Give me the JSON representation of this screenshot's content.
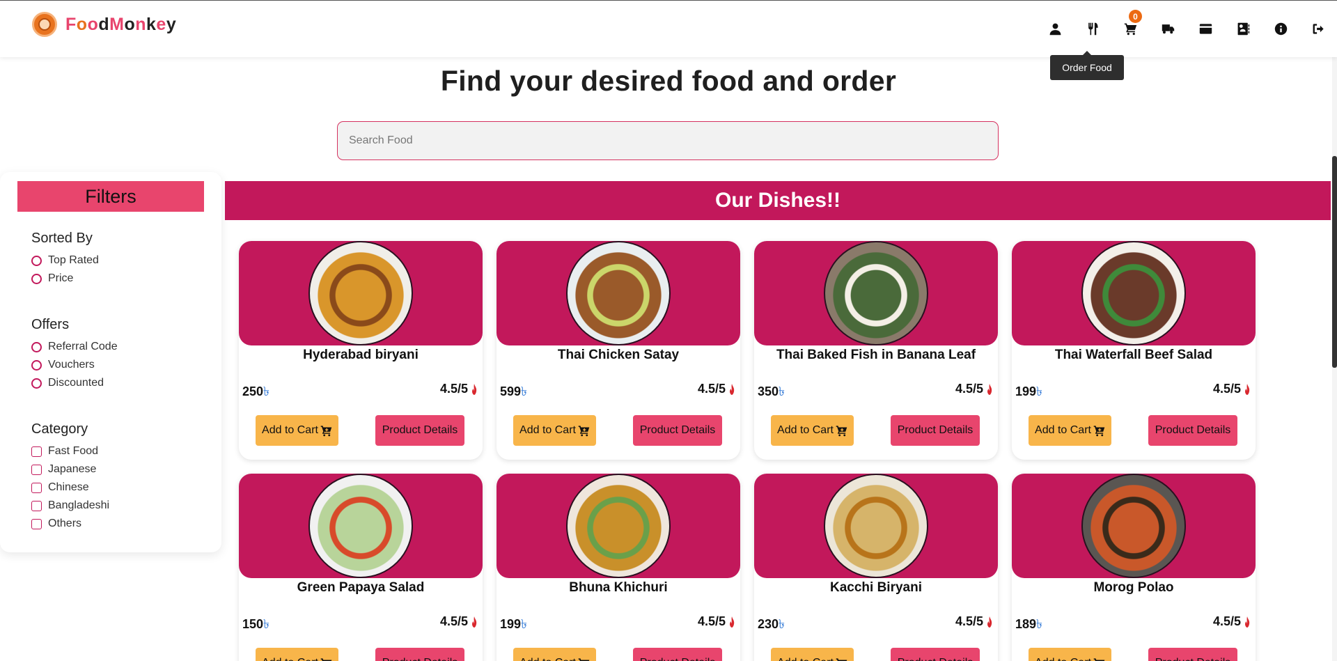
{
  "brand": {
    "name_parts": [
      "F",
      "o",
      "o",
      "d",
      "M",
      "o",
      "n",
      "k",
      "e",
      "y"
    ],
    "name_colors": [
      "#e8456d",
      "#e8731f",
      "#e8456d",
      "#222222",
      "#e8456d",
      "#222222",
      "#e8456d",
      "#222222",
      "#e8456d",
      "#222222"
    ]
  },
  "nav": {
    "icons": [
      "user-icon",
      "utensils-icon",
      "cart-icon",
      "truck-icon",
      "credit-card-icon",
      "contacts-icon",
      "info-icon",
      "logout-icon"
    ],
    "cart_count": "0",
    "tooltip": "Order Food"
  },
  "hero": {
    "headline": "Find your desired food and order",
    "search_placeholder": "Search Food"
  },
  "filters": {
    "title": "Filters",
    "sorted_by": {
      "title": "Sorted By",
      "options": [
        "Top Rated",
        "Price"
      ]
    },
    "offers": {
      "title": "Offers",
      "options": [
        "Referral Code",
        "Vouchers",
        "Discounted"
      ]
    },
    "category": {
      "title": "Category",
      "options": [
        "Fast Food",
        "Japanese",
        "Chinese",
        "Bangladeshi",
        "Others"
      ]
    }
  },
  "dishes": {
    "banner": "Our Dishes!!",
    "currency": "৳",
    "add_to_cart_label": "Add to Cart",
    "details_label": "Product Details",
    "items": [
      {
        "name": "Hyderabad biryani",
        "price": "250",
        "rating": "4.5/5",
        "plate": "#f0eee8",
        "food": "#d9962b",
        "accent": "#8a4a1a"
      },
      {
        "name": "Thai Chicken Satay",
        "price": "599",
        "rating": "4.5/5",
        "plate": "#e9eef0",
        "food": "#9a5a2a",
        "accent": "#cbd66a"
      },
      {
        "name": "Thai Baked Fish in Banana Leaf",
        "price": "350",
        "rating": "4.5/5",
        "plate": "#8a7a6a",
        "food": "#4a6a3a",
        "accent": "#f4efe6"
      },
      {
        "name": "Thai Waterfall Beef Salad",
        "price": "199",
        "rating": "4.5/5",
        "plate": "#f3efe9",
        "food": "#6a3a2a",
        "accent": "#3f8a3a"
      },
      {
        "name": "Green Papaya Salad",
        "price": "150",
        "rating": "4.5/5",
        "plate": "#f1f1f1",
        "food": "#b8d49a",
        "accent": "#d84a2a"
      },
      {
        "name": "Bhuna Khichuri",
        "price": "199",
        "rating": "4.5/5",
        "plate": "#efe6dc",
        "food": "#c9902a",
        "accent": "#6aa04a"
      },
      {
        "name": "Kacchi Biryani",
        "price": "230",
        "rating": "4.5/5",
        "plate": "#ece6d8",
        "food": "#d6b46a",
        "accent": "#b8741a"
      },
      {
        "name": "Morog Polao",
        "price": "189",
        "rating": "4.5/5",
        "plate": "#5a5652",
        "food": "#c9582a",
        "accent": "#3a2a1a"
      }
    ]
  }
}
